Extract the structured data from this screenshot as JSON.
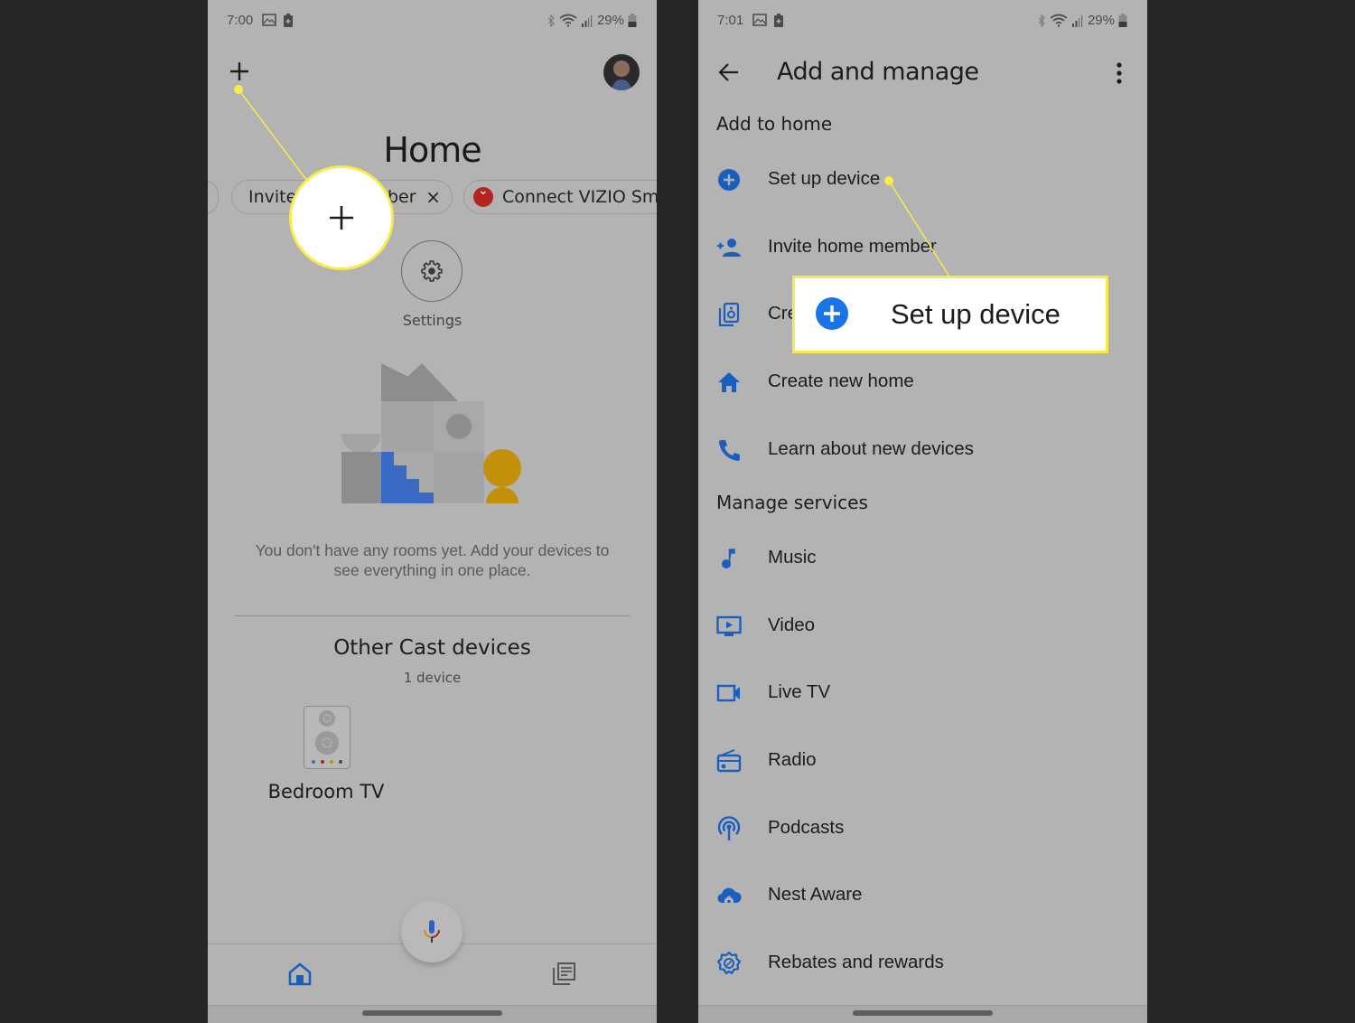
{
  "colors": {
    "background": "#262626",
    "screen_dim": "#b3b3b3",
    "accent_blue": "#1a5fc0",
    "callout_yellow": "#f7ec4a",
    "vizio_red": "#b3261e"
  },
  "left_screen": {
    "status_bar": {
      "time": "7:00",
      "battery": "29%"
    },
    "title": "Home",
    "chips": [
      {
        "label": "Invite home member",
        "visible_label_left": "Invite",
        "visible_label_right": "ber",
        "close_icon": "×"
      },
      {
        "label": "Connect VIZIO Sma",
        "icon": "vizio-logo"
      }
    ],
    "settings_label": "Settings",
    "empty_message": "You don't have any rooms yet. Add your devices to see everything in one place.",
    "other_devices": {
      "title": "Other Cast devices",
      "count": "1 device",
      "devices": [
        {
          "name": "Bedroom TV",
          "icon": "speaker-icon"
        }
      ]
    },
    "bottom_nav": [
      {
        "name": "home",
        "icon": "home-icon",
        "active": true
      },
      {
        "name": "feed",
        "icon": "feed-icon",
        "active": false
      }
    ],
    "callout": {
      "highlight": "add",
      "symbol": "+"
    }
  },
  "right_screen": {
    "status_bar": {
      "time": "7:01",
      "battery": "29%"
    },
    "header": {
      "title": "Add and manage"
    },
    "sections": [
      {
        "title": "Add to home",
        "items": [
          {
            "label": "Set up device",
            "icon": "add-circle-icon"
          },
          {
            "label": "Invite home member",
            "icon": "person-add-icon"
          },
          {
            "label": "Create speaker group",
            "visible_label": "Cre",
            "icon": "speaker-group-icon"
          },
          {
            "label": "Create new home",
            "icon": "home-icon"
          },
          {
            "label": "Learn about new devices",
            "icon": "phone-icon"
          }
        ]
      },
      {
        "title": "Manage services",
        "items": [
          {
            "label": "Music",
            "icon": "music-note-icon"
          },
          {
            "label": "Video",
            "icon": "video-icon"
          },
          {
            "label": "Live TV",
            "icon": "videocam-icon"
          },
          {
            "label": "Radio",
            "icon": "radio-icon"
          },
          {
            "label": "Podcasts",
            "icon": "podcast-icon"
          },
          {
            "label": "Nest Aware",
            "icon": "nest-aware-icon"
          },
          {
            "label": "Rebates and rewards",
            "icon": "rebates-icon"
          }
        ]
      }
    ],
    "callout": {
      "label": "Set up device",
      "icon": "add-circle-icon"
    }
  }
}
